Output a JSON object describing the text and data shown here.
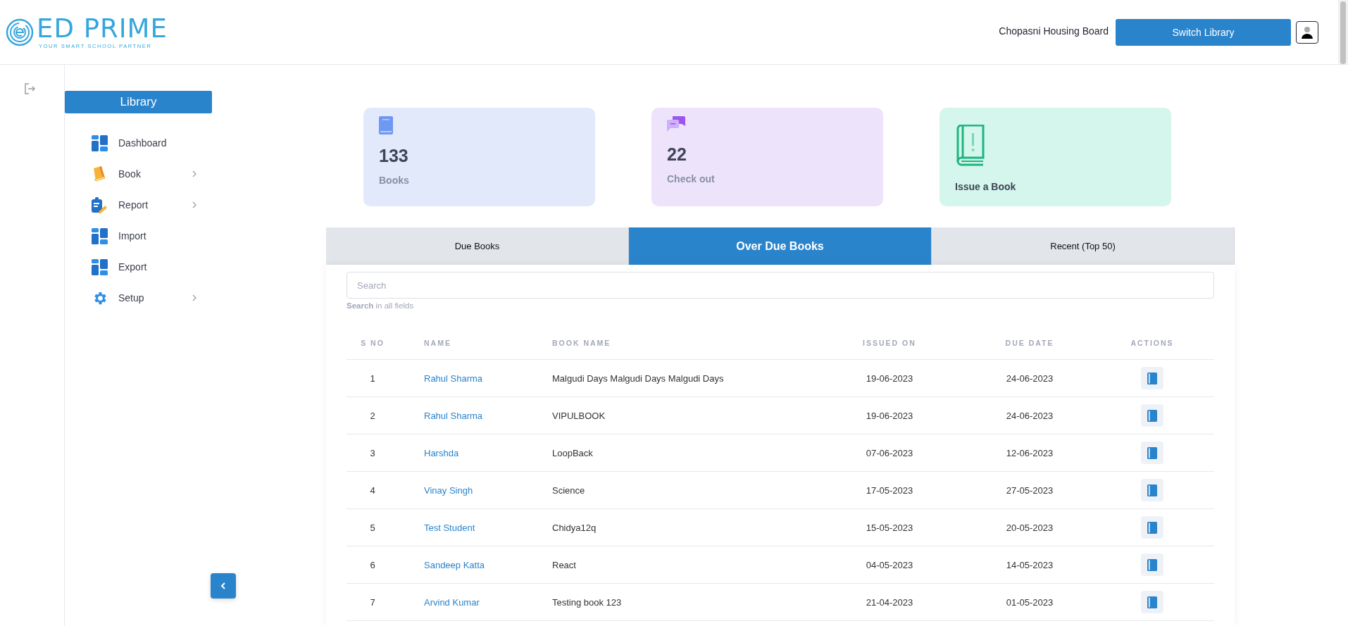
{
  "header": {
    "logo": {
      "name": "ED PRIME",
      "tagline": "YOUR SMART SCHOOL PARTNER"
    },
    "school": "Chopasni Housing Board",
    "switch_button": "Switch Library"
  },
  "sidebar": {
    "title": "Library",
    "items": [
      {
        "label": "Dashboard",
        "submenu": false
      },
      {
        "label": "Book",
        "submenu": true
      },
      {
        "label": "Report",
        "submenu": true
      },
      {
        "label": "Import",
        "submenu": false
      },
      {
        "label": "Export",
        "submenu": false
      },
      {
        "label": "Setup",
        "submenu": true
      }
    ]
  },
  "stats": [
    {
      "kind": "count",
      "color": "#e1e9fb",
      "value": "133",
      "label": "Books"
    },
    {
      "kind": "count",
      "color": "#ede4fc",
      "value": "22",
      "label": "Check out"
    },
    {
      "kind": "action",
      "color": "#d5f6ec",
      "label": "Issue a Book"
    }
  ],
  "tabs": [
    {
      "label": "Due Books",
      "selected": false
    },
    {
      "label": "Over Due Books",
      "selected": true
    },
    {
      "label": "Recent (Top 50)",
      "selected": false
    }
  ],
  "search": {
    "placeholder": "Search",
    "hint": "**Search** in all fields"
  },
  "table": {
    "columns": [
      "S NO",
      "NAME",
      "BOOK NAME",
      "ISSUED ON",
      "DUE DATE",
      "ACTIONS"
    ],
    "rows": [
      {
        "s_no": "1",
        "name": "Rahul Sharma",
        "book_name": "Malgudi Days Malgudi Days Malgudi Days",
        "issued_on": "19-06-2023",
        "due_date": "24-06-2023"
      },
      {
        "s_no": "2",
        "name": "Rahul Sharma",
        "book_name": "VIPULBOOK",
        "issued_on": "19-06-2023",
        "due_date": "24-06-2023"
      },
      {
        "s_no": "3",
        "name": "Harshda",
        "book_name": "LoopBack",
        "issued_on": "07-06-2023",
        "due_date": "12-06-2023"
      },
      {
        "s_no": "4",
        "name": "Vinay Singh",
        "book_name": "Science",
        "issued_on": "17-05-2023",
        "due_date": "27-05-2023"
      },
      {
        "s_no": "5",
        "name": "Test Student",
        "book_name": "Chidya12q",
        "issued_on": "15-05-2023",
        "due_date": "20-05-2023"
      },
      {
        "s_no": "6",
        "name": "Sandeep Katta",
        "book_name": "React",
        "issued_on": "04-05-2023",
        "due_date": "14-05-2023"
      },
      {
        "s_no": "7",
        "name": "Arvind Kumar",
        "book_name": "Testing book 123",
        "issued_on": "21-04-2023",
        "due_date": "01-05-2023"
      }
    ]
  }
}
